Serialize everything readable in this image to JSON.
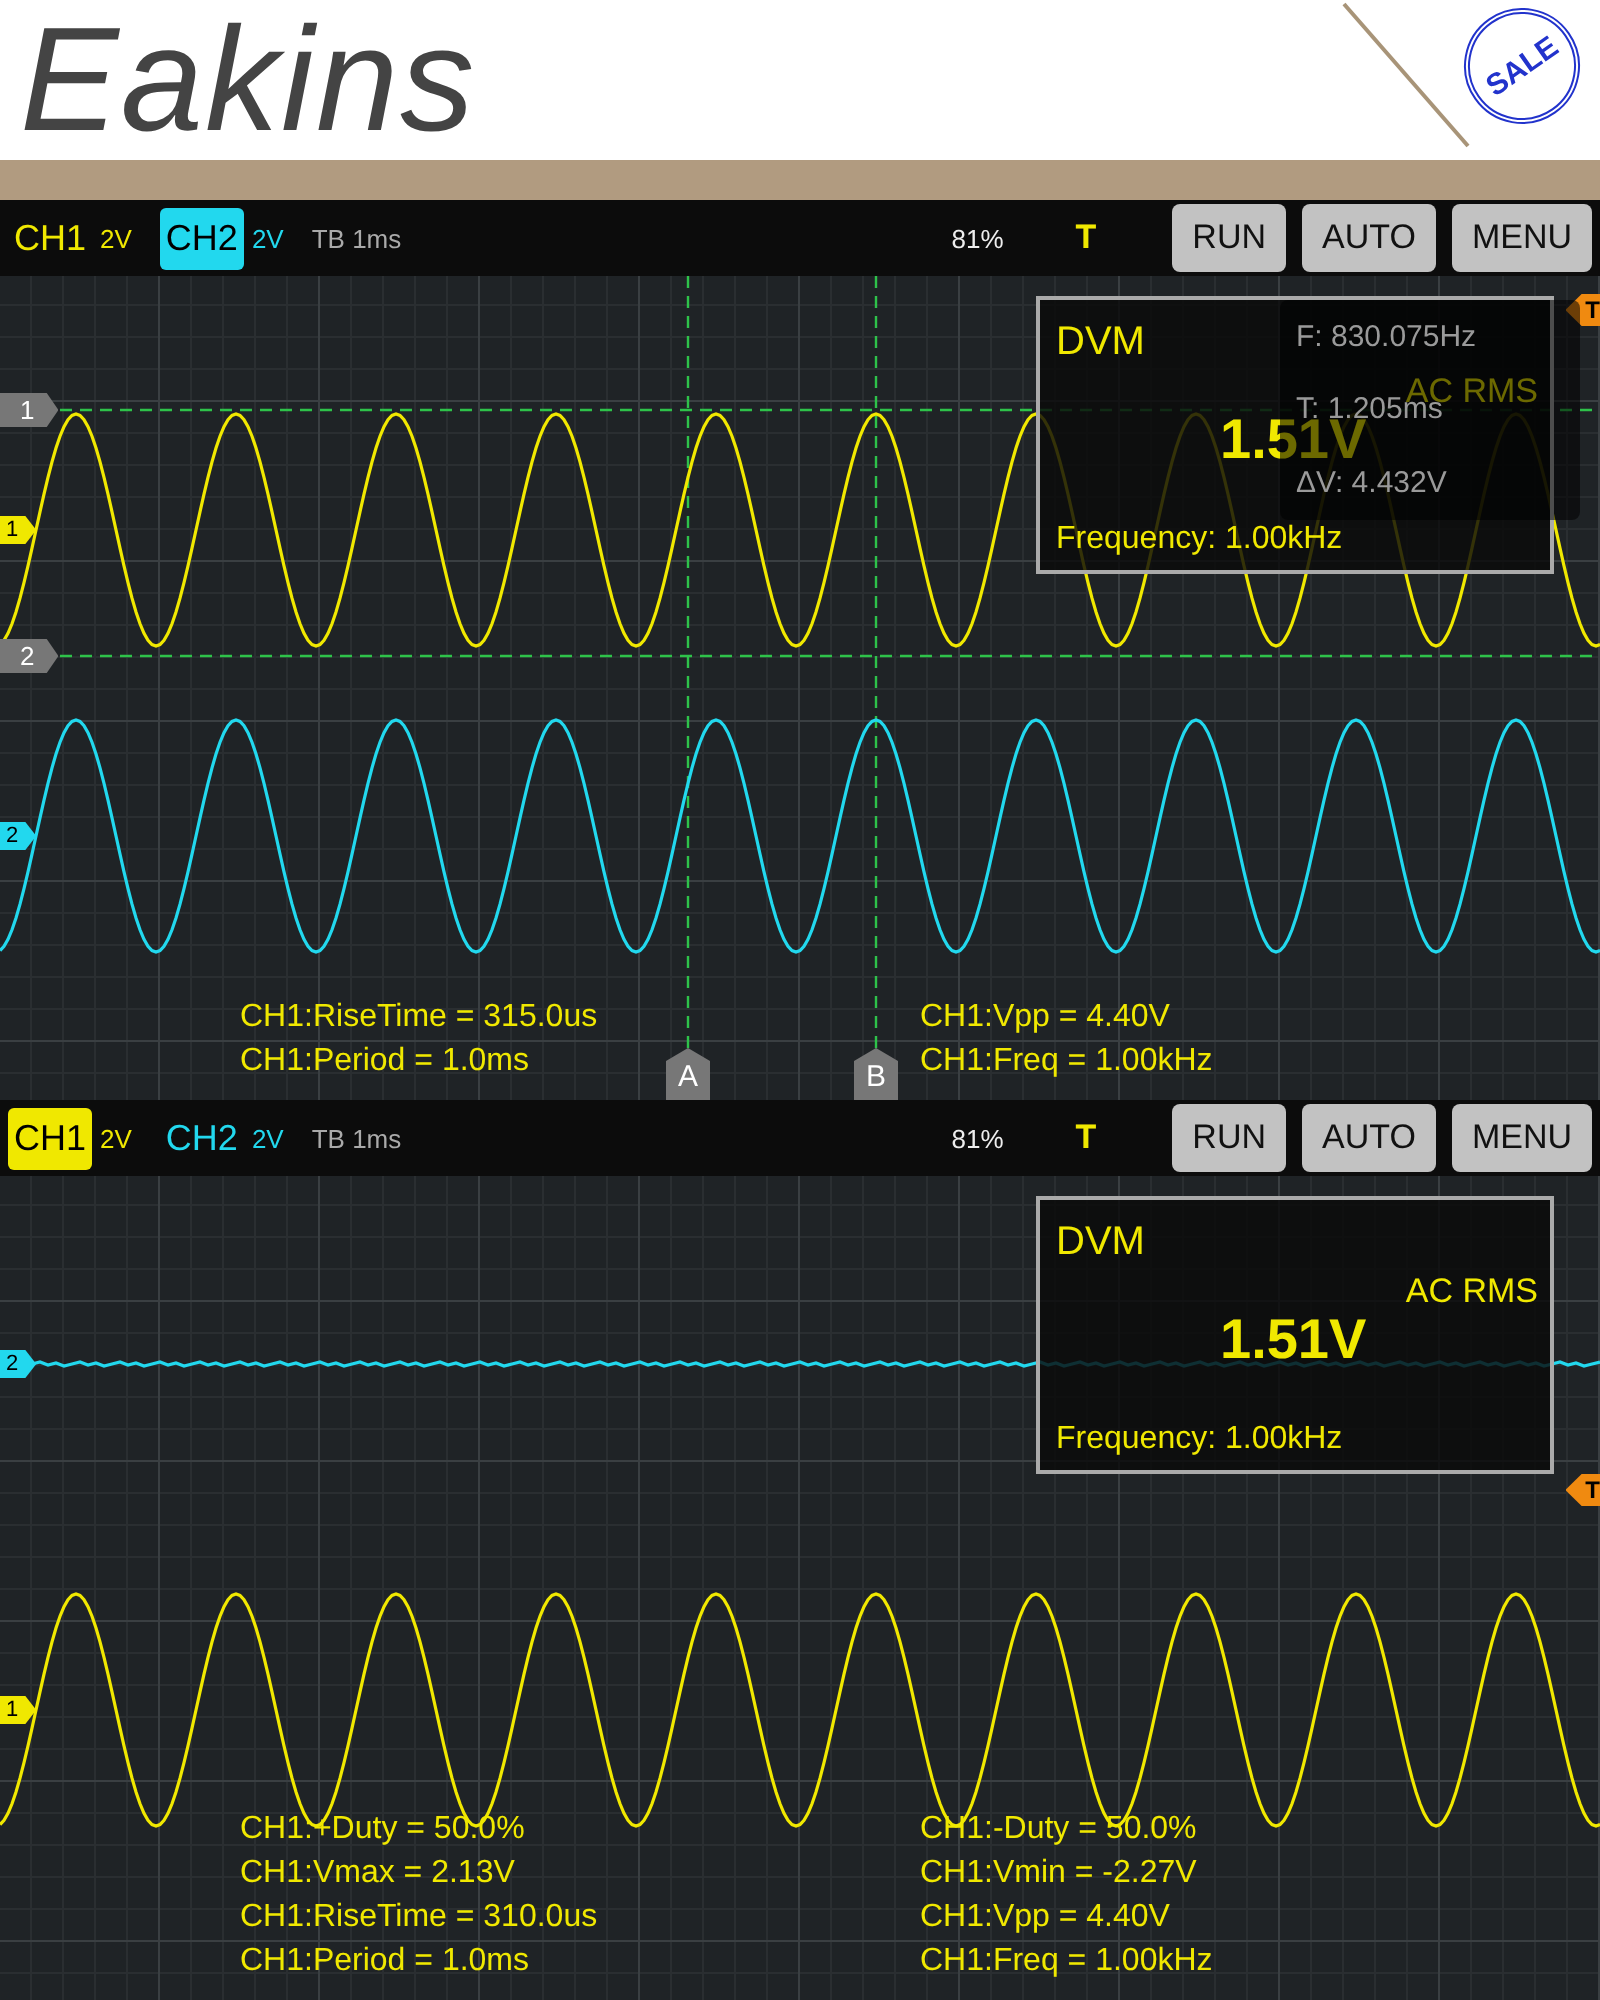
{
  "header": {
    "brand": "Eakins",
    "stamp": "SALE"
  },
  "scopes": [
    {
      "toolbar": {
        "channels": [
          {
            "label": "CH1",
            "scale": "2V",
            "selected": false,
            "color": "#f0e800"
          },
          {
            "label": "CH2",
            "scale": "2V",
            "selected": true,
            "color": "#22d8ee"
          }
        ],
        "timebase": "TB 1ms",
        "percent": "81%",
        "trigger": "T",
        "buttons": [
          "RUN",
          "AUTO",
          "MENU"
        ]
      },
      "traces": [
        {
          "marker": "1",
          "kind": "sine",
          "color": "#f0e800"
        },
        {
          "marker": "2",
          "kind": "sine",
          "color": "#22d8ee"
        }
      ],
      "trigger_marker": "T",
      "cursors": {
        "horizontal": [
          "1",
          "2"
        ],
        "vertical": [
          "A",
          "B"
        ]
      },
      "dvm": {
        "title": "DVM",
        "mode": "AC RMS",
        "value": "1.51V",
        "frequency": "Frequency: 1.00kHz"
      },
      "cursor_readout": [
        "F: 830.075Hz",
        "T: 1.205ms",
        "ΔV: 4.432V"
      ],
      "measurements": {
        "left": [
          "CH1:RiseTime = 315.0us",
          "CH1:Period = 1.0ms"
        ],
        "right": [
          "CH1:Vpp = 4.40V",
          "CH1:Freq = 1.00kHz"
        ]
      }
    },
    {
      "toolbar": {
        "channels": [
          {
            "label": "CH1",
            "scale": "2V",
            "selected": true,
            "color": "#f0e800"
          },
          {
            "label": "CH2",
            "scale": "2V",
            "selected": false,
            "color": "#22d8ee"
          }
        ],
        "timebase": "TB 1ms",
        "percent": "81%",
        "trigger": "T",
        "buttons": [
          "RUN",
          "AUTO",
          "MENU"
        ]
      },
      "traces": [
        {
          "marker": "2",
          "kind": "flat",
          "color": "#22d8ee"
        },
        {
          "marker": "1",
          "kind": "sine",
          "color": "#f0e800"
        }
      ],
      "trigger_marker": "T",
      "dvm": {
        "title": "DVM",
        "mode": "AC RMS",
        "value": "1.51V",
        "frequency": "Frequency: 1.00kHz"
      },
      "measurements": {
        "left": [
          "CH1:+Duty = 50.0%",
          "CH1:Vmax = 2.13V",
          "CH1:RiseTime = 310.0us",
          "CH1:Period = 1.0ms"
        ],
        "right": [
          "CH1:-Duty = 50.0%",
          "CH1:Vmin = -2.27V",
          "CH1:Vpp = 4.40V",
          "CH1:Freq = 1.00kHz"
        ]
      }
    }
  ]
}
